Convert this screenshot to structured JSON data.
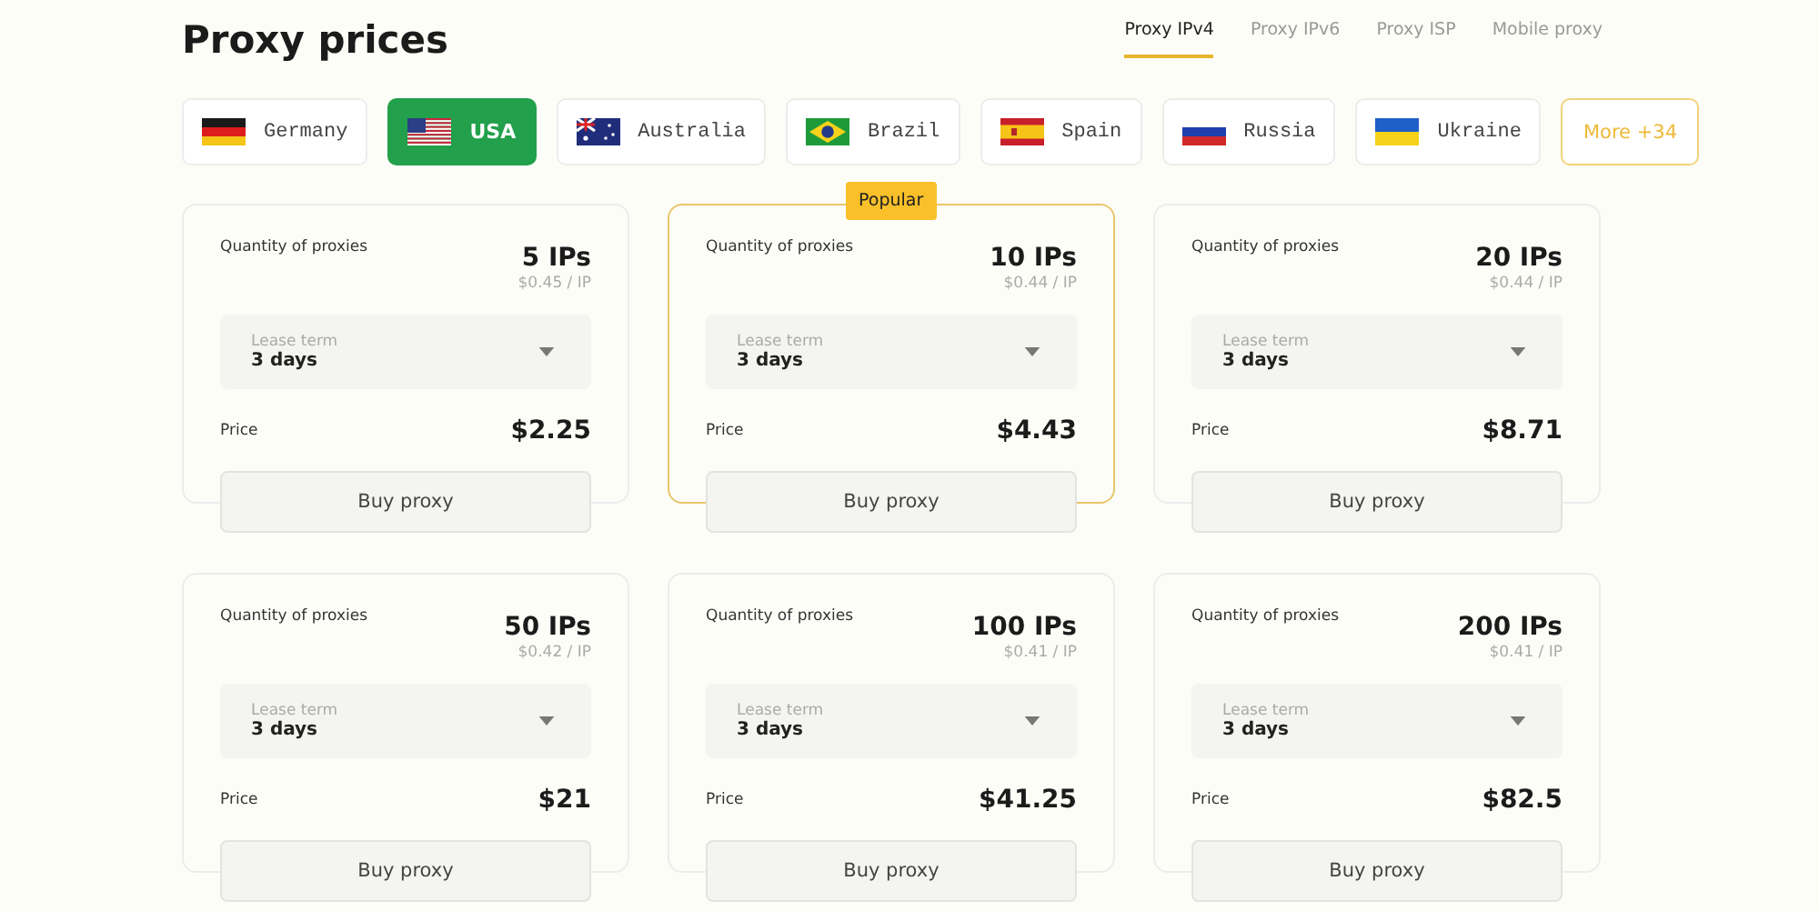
{
  "title": "Proxy prices",
  "tabs": [
    {
      "label": "Proxy IPv4",
      "selected": true
    },
    {
      "label": "Proxy IPv6",
      "selected": false
    },
    {
      "label": "Proxy ISP",
      "selected": false
    },
    {
      "label": "Mobile proxy",
      "selected": false
    }
  ],
  "countries": [
    {
      "name": "Germany",
      "kind": "de",
      "selected": false
    },
    {
      "name": "USA",
      "kind": "us",
      "selected": true
    },
    {
      "name": "Australia",
      "kind": "au",
      "selected": false
    },
    {
      "name": "Brazil",
      "kind": "br",
      "selected": false
    },
    {
      "name": "Spain",
      "kind": "es",
      "selected": false
    },
    {
      "name": "Russia",
      "kind": "ru",
      "selected": false
    },
    {
      "name": "Ukraine",
      "kind": "ua",
      "selected": false
    }
  ],
  "more_button": "More +34",
  "plans": [
    {
      "quantity_label": "Quantity of proxies",
      "quantity": "5 IPs",
      "per_ip": "$0.45 / IP",
      "lease_label": "Lease term",
      "lease": "3 days",
      "price_label": "Price",
      "price": "$2.25",
      "button": "Buy proxy",
      "popular": false
    },
    {
      "quantity_label": "Quantity of proxies",
      "quantity": "10 IPs",
      "per_ip": "$0.44 / IP",
      "lease_label": "Lease term",
      "lease": "3 days",
      "price_label": "Price",
      "price": "$4.43",
      "button": "Buy proxy",
      "popular": true,
      "badge": "Popular"
    },
    {
      "quantity_label": "Quantity of proxies",
      "quantity": "20 IPs",
      "per_ip": "$0.44 / IP",
      "lease_label": "Lease term",
      "lease": "3 days",
      "price_label": "Price",
      "price": "$8.71",
      "button": "Buy proxy",
      "popular": false
    },
    {
      "quantity_label": "Quantity of proxies",
      "quantity": "50 IPs",
      "per_ip": "$0.42 / IP",
      "lease_label": "Lease term",
      "lease": "3 days",
      "price_label": "Price",
      "price": "$21",
      "button": "Buy proxy",
      "popular": false
    },
    {
      "quantity_label": "Quantity of proxies",
      "quantity": "100 IPs",
      "per_ip": "$0.41 / IP",
      "lease_label": "Lease term",
      "lease": "3 days",
      "price_label": "Price",
      "price": "$41.25",
      "button": "Buy proxy",
      "popular": false
    },
    {
      "quantity_label": "Quantity of proxies",
      "quantity": "200 IPs",
      "per_ip": "$0.41 / IP",
      "lease_label": "Lease term",
      "lease": "3 days",
      "price_label": "Price",
      "price": "$82.5",
      "button": "Buy proxy",
      "popular": false
    }
  ]
}
